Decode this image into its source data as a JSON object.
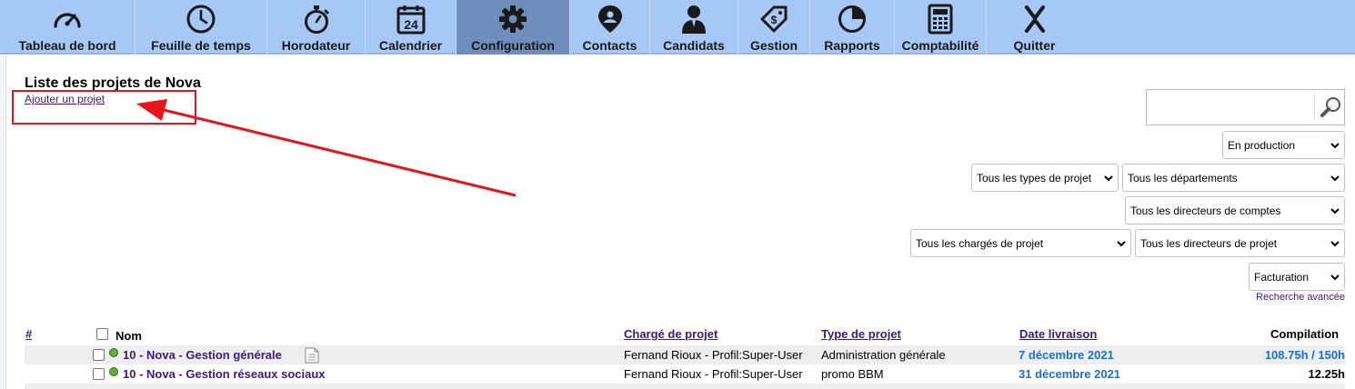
{
  "nav": {
    "items": [
      {
        "label": "Tableau de bord",
        "icon": "dashboard-gauge-icon"
      },
      {
        "label": "Feuille de temps",
        "icon": "clock-icon"
      },
      {
        "label": "Horodateur",
        "icon": "stopwatch-icon"
      },
      {
        "label": "Calendrier",
        "icon": "calendar-icon",
        "day": "24"
      },
      {
        "label": "Configuration",
        "icon": "gear-icon",
        "active": true
      },
      {
        "label": "Contacts",
        "icon": "contact-pin-icon"
      },
      {
        "label": "Candidats",
        "icon": "candidate-person-icon"
      },
      {
        "label": "Gestion",
        "icon": "price-tag-icon"
      },
      {
        "label": "Rapports",
        "icon": "pie-chart-icon"
      },
      {
        "label": "Comptabilité",
        "icon": "calculator-icon"
      },
      {
        "label": "Quitter",
        "icon": "close-x-icon"
      }
    ],
    "active_color": "#6e8fbe",
    "bar_color": "#a6c8f5"
  },
  "page": {
    "title": "Liste des projets de Nova",
    "add_link": "Ajouter un projet",
    "annotation_color": "#e8141b"
  },
  "search": {
    "value": "",
    "icon": "search-magnifier-icon"
  },
  "filters": {
    "status": "En production",
    "project_types": "Tous les types de projet",
    "departments": "Tous les départements",
    "account_directors": "Tous les directeurs de comptes",
    "project_managers": "Tous les chargés de projet",
    "project_directors": "Tous les directeurs de projet",
    "billing": "Facturation",
    "advanced_search": "Recherche avancée"
  },
  "table": {
    "headers": {
      "number": "#",
      "name": "Nom",
      "manager": "Chargé de projet",
      "type": "Type de projet",
      "delivery": "Date livraison",
      "compilation": "Compilation"
    },
    "rows": [
      {
        "name": "10 - Nova - Gestion générale",
        "manager": "Fernand Rioux - Profil:Super-User",
        "type": "Administration générale",
        "delivery": "7 décembre 2021",
        "compilation": "108.75h / 150h",
        "status": "green",
        "has_note": true
      },
      {
        "name": "10 - Nova - Gestion réseaux sociaux",
        "manager": "Fernand Rioux - Profil:Super-User",
        "type": "promo BBM",
        "delivery": "31 décembre 2021",
        "compilation": "12.25h",
        "status": "green",
        "has_note": false
      }
    ]
  }
}
